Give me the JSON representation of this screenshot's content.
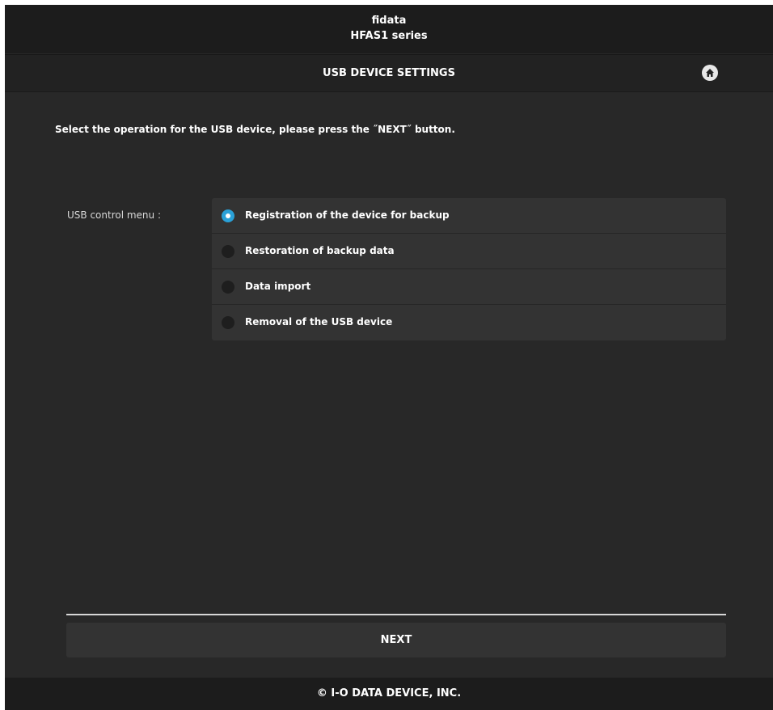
{
  "header": {
    "brand_name": "fidata",
    "brand_series": "HFAS1 series",
    "page_title": "USB DEVICE SETTINGS",
    "home_icon": "home-icon"
  },
  "main": {
    "instruction": "Select the operation for the USB device, please press the ˝NEXT˝ button.",
    "menu_label": "USB control menu :",
    "options": [
      {
        "label": "Registration of the device for backup",
        "selected": true
      },
      {
        "label": "Restoration of backup data",
        "selected": false
      },
      {
        "label": "Data import",
        "selected": false
      },
      {
        "label": "Removal of the USB device",
        "selected": false
      }
    ],
    "next_label": "NEXT"
  },
  "footer": {
    "copyright": "© I-O DATA DEVICE, INC."
  },
  "colors": {
    "accent": "#2aa1d8",
    "background": "#282828",
    "panel": "#333333"
  }
}
